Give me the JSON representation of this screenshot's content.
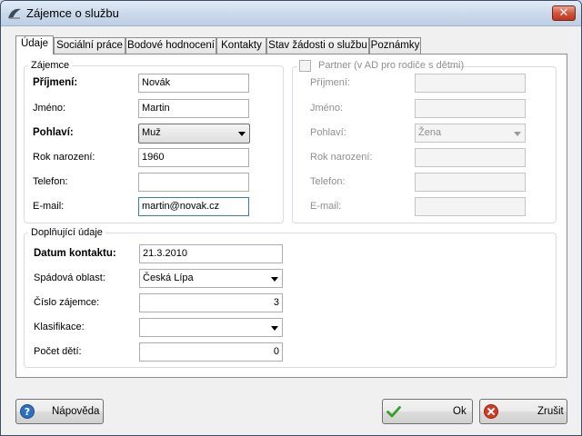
{
  "window": {
    "title": "Zájemce o službu",
    "close_glyph": "✕"
  },
  "tabs": [
    {
      "label": "Údaje"
    },
    {
      "label": "Sociální práce"
    },
    {
      "label": "Bodové hodnocení"
    },
    {
      "label": "Kontakty"
    },
    {
      "label": "Stav žádosti o službu"
    },
    {
      "label": "Poznámky"
    }
  ],
  "zajemce": {
    "legend": "Zájemce",
    "prijmeni_label": "Příjmení:",
    "prijmeni_value": "Novák",
    "jmeno_label": "Jméno:",
    "jmeno_value": "Martin",
    "pohlavi_label": "Pohlaví:",
    "pohlavi_value": "Muž",
    "rok_label": "Rok narození:",
    "rok_value": "1960",
    "telefon_label": "Telefon:",
    "telefon_value": "",
    "email_label": "E-mail:",
    "email_value": "martin@novak.cz"
  },
  "partner": {
    "legend": "Partner (v AD pro rodiče s dětmi)",
    "checked": false,
    "prijmeni_label": "Příjmení:",
    "jmeno_label": "Jméno:",
    "pohlavi_label": "Pohlaví:",
    "pohlavi_value": "Žena",
    "rok_label": "Rok narození:",
    "telefon_label": "Telefon:",
    "email_label": "E-mail:"
  },
  "doplnujici": {
    "legend": "Doplňující údaje",
    "datum_label": "Datum kontaktu:",
    "datum_value": "21.3.2010",
    "oblast_label": "Spádová oblast:",
    "oblast_value": "Česká Lípa",
    "cislo_label": "Číslo zájemce:",
    "cislo_value": "3",
    "klasifikace_label": "Klasifikace:",
    "klasifikace_value": "",
    "pocet_label": "Počet dětí:",
    "pocet_value": "0"
  },
  "buttons": {
    "help_label": "Nápověda",
    "ok_label": "Ok",
    "cancel_label": "Zrušit"
  },
  "colors": {
    "accent_focus": "#3d7bad",
    "ok_green": "#3a9d2b",
    "cancel_red": "#d23a22",
    "help_blue": "#2f6fc0"
  }
}
